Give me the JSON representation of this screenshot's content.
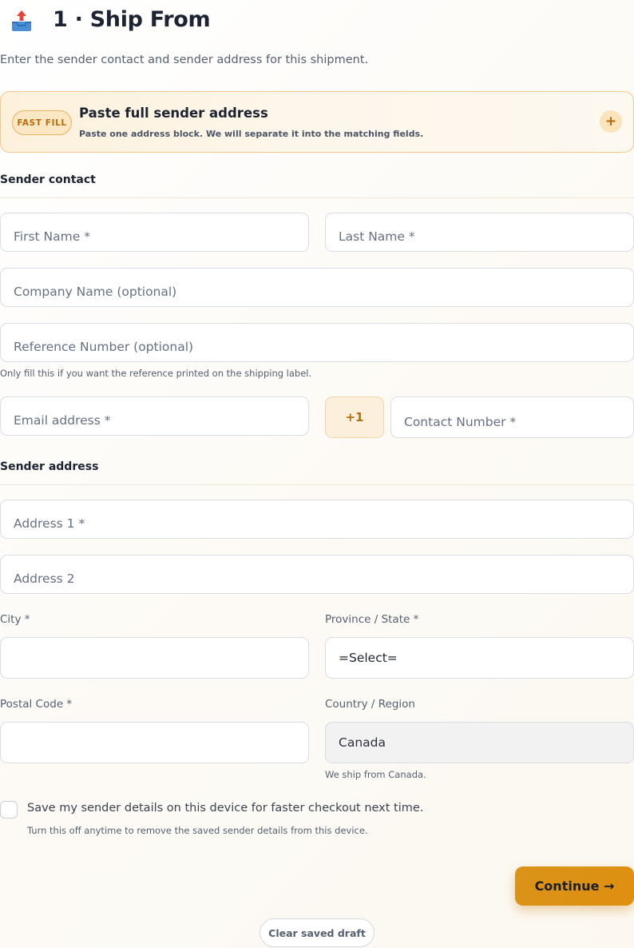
{
  "header": {
    "icon": "outbox-tray-icon",
    "title": "1 · Ship From",
    "subtitle": "Enter the sender contact and sender address for this shipment."
  },
  "fast_fill": {
    "badge": "FAST FILL",
    "title": "Paste full sender address",
    "description": "Paste one address block. We will separate it into the matching fields.",
    "expand_symbol": "+"
  },
  "sender_contact": {
    "heading": "Sender contact",
    "first_name_placeholder": "First Name *",
    "last_name_placeholder": "Last Name *",
    "company_placeholder": "Company Name (optional)",
    "reference_placeholder": "Reference Number (optional)",
    "reference_hint": "Only fill this if you want the reference printed on the shipping label.",
    "email_placeholder": "Email address *",
    "phone_prefix": "+1",
    "phone_placeholder": "Contact Number *"
  },
  "sender_address": {
    "heading": "Sender address",
    "address1_placeholder": "Address 1 *",
    "address2_placeholder": "Address 2",
    "city_label": "City *",
    "city_value": "",
    "province_label": "Province / State *",
    "province_value": "=Select=",
    "postal_label": "Postal Code *",
    "postal_value": "",
    "country_label": "Country / Region",
    "country_value": "Canada",
    "country_hint": "We ship from Canada."
  },
  "save_details": {
    "checked": false,
    "label": "Save my sender details on this device for faster checkout next time.",
    "hint": "Turn this off anytime to remove the saved sender details from this device."
  },
  "actions": {
    "continue_label": "Continue →",
    "clear_label": "Clear saved draft"
  },
  "colors": {
    "accent": "#e08f10",
    "fast_fill_border": "#f0c98a",
    "text_primary": "#1c2433",
    "text_muted": "#555f70"
  }
}
